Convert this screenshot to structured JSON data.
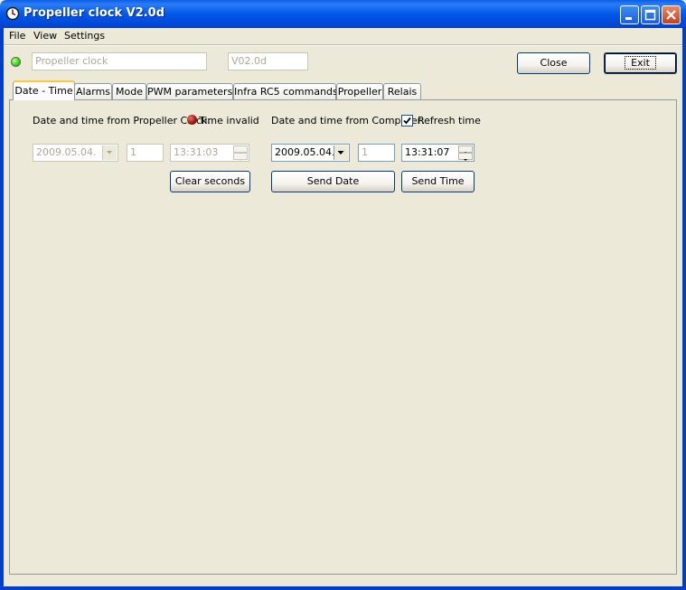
{
  "window": {
    "title": "Propeller clock V2.0d",
    "icon": "clock-icon",
    "controls": [
      "minimize-icon",
      "maximize-icon",
      "close-icon"
    ]
  },
  "menu": [
    "File",
    "View",
    "Settings"
  ],
  "header": {
    "status_led_color": "#2ad200",
    "device_name": "Propeller clock",
    "version": "V02.0d",
    "close_label": "Close",
    "exit_label": "Exit"
  },
  "tabs": [
    "Date - Time",
    "Alarms",
    "Mode",
    "PWM parameters",
    "Infra RC5 commands",
    "Propeller",
    "Relais"
  ],
  "active_tab": "Date - Time",
  "clock_section": {
    "label": "Date and time from Propeller Clock:",
    "led_color": "#9a1a10",
    "status": "Time invalid",
    "date": "2009.05.04.",
    "day": "1",
    "time": "13:31:03",
    "clear_label": "Clear seconds"
  },
  "computer_section": {
    "label": "Date and time from Computer:",
    "refresh_checked": true,
    "refresh_label": "Refresh time",
    "date": "2009.05.04.",
    "day": "1",
    "time": "13:31:07",
    "send_date_label": "Send Date",
    "send_time_label": "Send Time"
  }
}
